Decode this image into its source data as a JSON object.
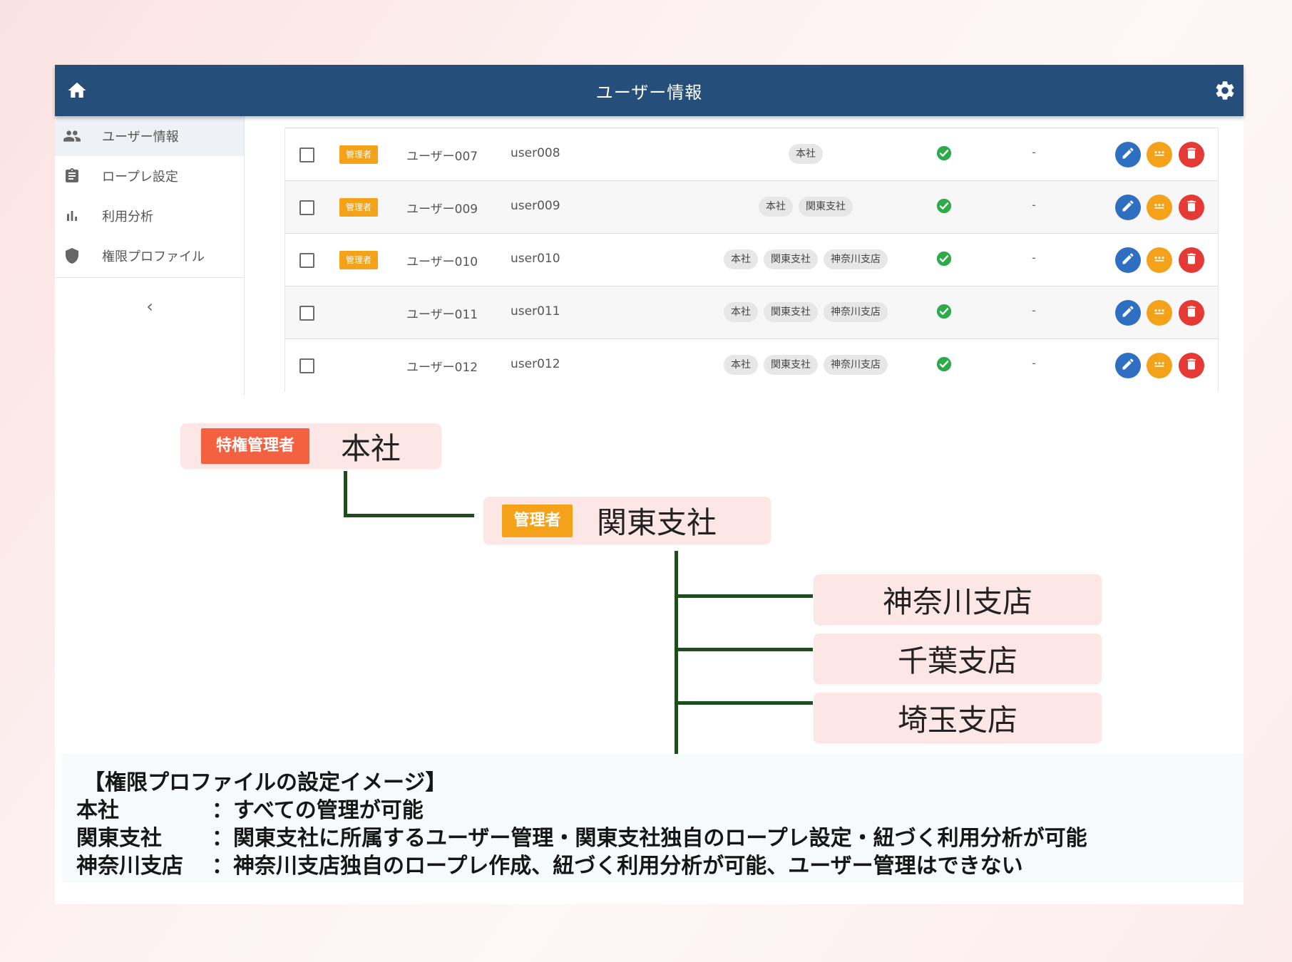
{
  "app": {
    "title": "ユーザー情報"
  },
  "sidebar": {
    "items": [
      {
        "label": "ユーザー情報",
        "icon": "people-icon",
        "active": true
      },
      {
        "label": "ロープレ設定",
        "icon": "clipboard-icon",
        "active": false
      },
      {
        "label": "利用分析",
        "icon": "bar-chart-icon",
        "active": false
      },
      {
        "label": "権限プロファイル",
        "icon": "shield-icon",
        "active": false
      }
    ],
    "collapse_label": "‹"
  },
  "table": {
    "rows": [
      {
        "role": "管理者",
        "name": "ユーザー007",
        "id": "user008",
        "offices": [
          "本社"
        ],
        "status": "check",
        "extra": "-"
      },
      {
        "role": "管理者",
        "name": "ユーザー009",
        "id": "user009",
        "offices": [
          "本社",
          "関東支社"
        ],
        "status": "check",
        "extra": "-"
      },
      {
        "role": "管理者",
        "name": "ユーザー010",
        "id": "user010",
        "offices": [
          "本社",
          "関東支社",
          "神奈川支店"
        ],
        "status": "check",
        "extra": "-"
      },
      {
        "role": "",
        "name": "ユーザー011",
        "id": "user011",
        "offices": [
          "本社",
          "関東支社",
          "神奈川支店"
        ],
        "status": "check",
        "extra": "-"
      },
      {
        "role": "",
        "name": "ユーザー012",
        "id": "user012",
        "offices": [
          "本社",
          "関東支社",
          "神奈川支店"
        ],
        "status": "check",
        "extra": "-"
      }
    ]
  },
  "diagram": {
    "root": {
      "tag": "特権管理者",
      "label": "本社"
    },
    "mid": {
      "tag": "管理者",
      "label": "関東支社"
    },
    "leaves": [
      "神奈川支店",
      "千葉支店",
      "埼玉支店"
    ]
  },
  "legend": {
    "heading": "【権限プロファイルの設定イメージ】",
    "lines": [
      {
        "key": "本社",
        "value": "：すべての管理が可能"
      },
      {
        "key": "関東支社",
        "value": "：関東支社に所属するユーザー管理・関東支社独自のロープレ設定・紐づく利用分析が可能"
      },
      {
        "key": "神奈川支店",
        "value": "：神奈川支店独自のロープレ作成、紐づく利用分析が可能、ユーザー管理はできない"
      }
    ]
  },
  "colors": {
    "topbar": "#254e7b",
    "role_badge": "#f5a21b",
    "privileged_tag": "#f36141",
    "node_bg": "#fde6e6",
    "connector": "#1e4d1c",
    "edit": "#2e6fc2",
    "more": "#f5a21b",
    "delete": "#e53935",
    "check": "#2eaa4a"
  }
}
